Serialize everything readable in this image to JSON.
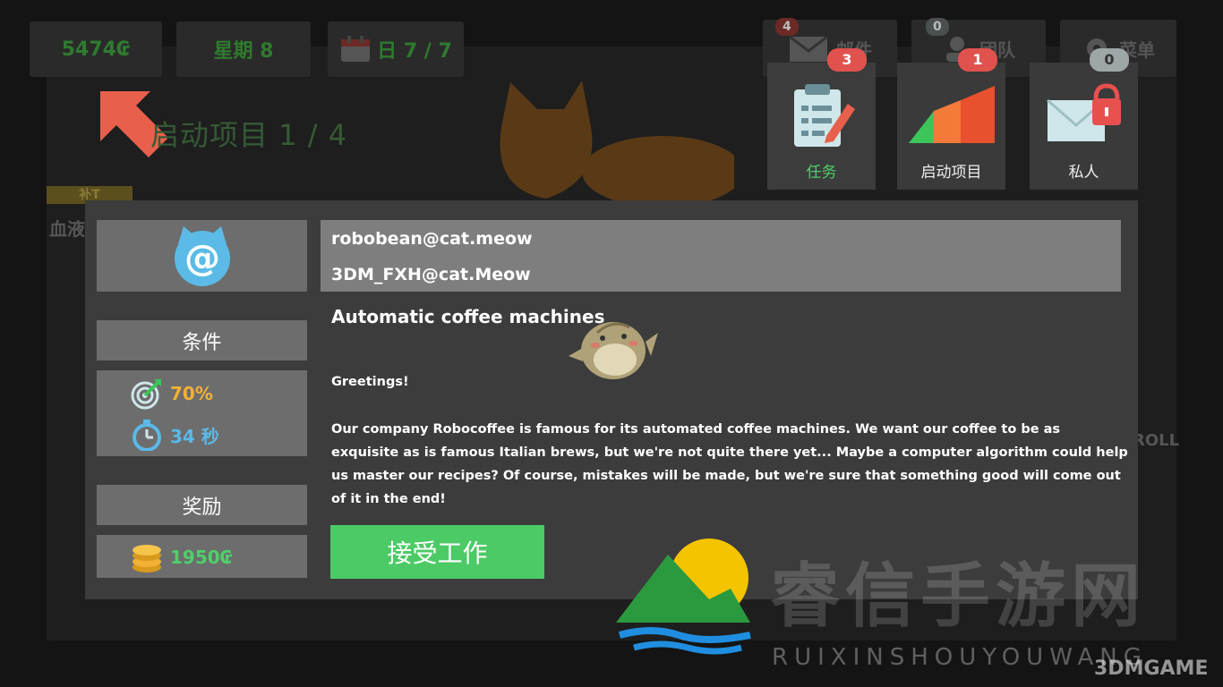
{
  "hud": {
    "money": "5474₢",
    "week": "星期 8",
    "day": "日 7 / 7",
    "mail_label": "邮件",
    "mail_count": "4",
    "team_label": "团队",
    "team_count": "0",
    "menu_label": "菜单",
    "staff_label": "补T",
    "blood_label": "血液",
    "roll_label": "ROLL"
  },
  "project_title_bg": "启动项目 1 / 4",
  "tabs": [
    {
      "label": "任务",
      "badge": "3",
      "active": true
    },
    {
      "label": "启动项目",
      "badge": "1",
      "active": false
    },
    {
      "label": "私人",
      "badge": "0",
      "active": false
    }
  ],
  "dialog": {
    "emails": {
      "from": "robobean@cat.meow",
      "to": "3DM_FXH@cat.Meow"
    },
    "job_title": "Automatic coffee machines",
    "greeting": "Greetings!",
    "body": "Our company Robocoffee is famous for its automated coffee machines. We want our coffee to be as exquisite as is famous Italian brews, but we're not quite there yet... Maybe a computer algorithm could help us master our recipes? Of course, mistakes will be made, but we're sure that something good will come out of it in the end!",
    "conditions_label": "条件",
    "accuracy": "70%",
    "time_limit": "34 秒",
    "reward_label": "奖励",
    "reward": "1950₢",
    "accept_label": "接受工作"
  },
  "colors": {
    "accent_green": "#4cca66",
    "accuracy_yellow": "#f2b134",
    "time_blue": "#5bb8e8",
    "badge_red": "#e0524e",
    "badge_gray": "#9ea6a8",
    "arrow_red": "#e8604c"
  },
  "watermark": {
    "cn": "睿信手游网",
    "en": "RUIXINSHOUYOUWANG",
    "site": "3DMGAME"
  }
}
